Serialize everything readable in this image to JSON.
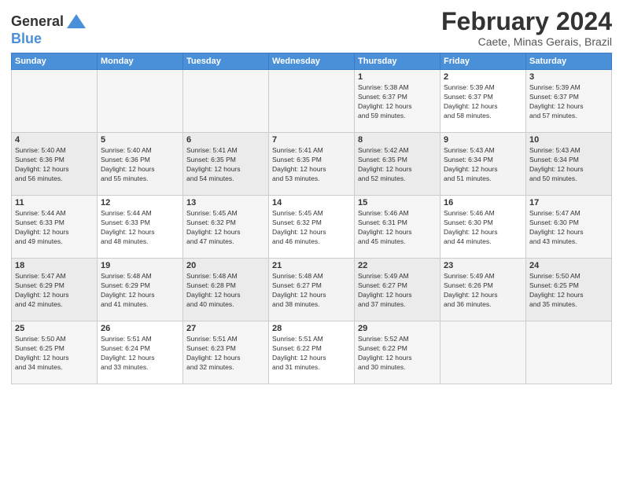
{
  "header": {
    "logo_line1": "General",
    "logo_line2": "Blue",
    "title": "February 2024",
    "subtitle": "Caete, Minas Gerais, Brazil"
  },
  "weekdays": [
    "Sunday",
    "Monday",
    "Tuesday",
    "Wednesday",
    "Thursday",
    "Friday",
    "Saturday"
  ],
  "weeks": [
    [
      {
        "day": "",
        "info": ""
      },
      {
        "day": "",
        "info": ""
      },
      {
        "day": "",
        "info": ""
      },
      {
        "day": "",
        "info": ""
      },
      {
        "day": "1",
        "info": "Sunrise: 5:38 AM\nSunset: 6:37 PM\nDaylight: 12 hours\nand 59 minutes."
      },
      {
        "day": "2",
        "info": "Sunrise: 5:39 AM\nSunset: 6:37 PM\nDaylight: 12 hours\nand 58 minutes."
      },
      {
        "day": "3",
        "info": "Sunrise: 5:39 AM\nSunset: 6:37 PM\nDaylight: 12 hours\nand 57 minutes."
      }
    ],
    [
      {
        "day": "4",
        "info": "Sunrise: 5:40 AM\nSunset: 6:36 PM\nDaylight: 12 hours\nand 56 minutes."
      },
      {
        "day": "5",
        "info": "Sunrise: 5:40 AM\nSunset: 6:36 PM\nDaylight: 12 hours\nand 55 minutes."
      },
      {
        "day": "6",
        "info": "Sunrise: 5:41 AM\nSunset: 6:35 PM\nDaylight: 12 hours\nand 54 minutes."
      },
      {
        "day": "7",
        "info": "Sunrise: 5:41 AM\nSunset: 6:35 PM\nDaylight: 12 hours\nand 53 minutes."
      },
      {
        "day": "8",
        "info": "Sunrise: 5:42 AM\nSunset: 6:35 PM\nDaylight: 12 hours\nand 52 minutes."
      },
      {
        "day": "9",
        "info": "Sunrise: 5:43 AM\nSunset: 6:34 PM\nDaylight: 12 hours\nand 51 minutes."
      },
      {
        "day": "10",
        "info": "Sunrise: 5:43 AM\nSunset: 6:34 PM\nDaylight: 12 hours\nand 50 minutes."
      }
    ],
    [
      {
        "day": "11",
        "info": "Sunrise: 5:44 AM\nSunset: 6:33 PM\nDaylight: 12 hours\nand 49 minutes."
      },
      {
        "day": "12",
        "info": "Sunrise: 5:44 AM\nSunset: 6:33 PM\nDaylight: 12 hours\nand 48 minutes."
      },
      {
        "day": "13",
        "info": "Sunrise: 5:45 AM\nSunset: 6:32 PM\nDaylight: 12 hours\nand 47 minutes."
      },
      {
        "day": "14",
        "info": "Sunrise: 5:45 AM\nSunset: 6:32 PM\nDaylight: 12 hours\nand 46 minutes."
      },
      {
        "day": "15",
        "info": "Sunrise: 5:46 AM\nSunset: 6:31 PM\nDaylight: 12 hours\nand 45 minutes."
      },
      {
        "day": "16",
        "info": "Sunrise: 5:46 AM\nSunset: 6:30 PM\nDaylight: 12 hours\nand 44 minutes."
      },
      {
        "day": "17",
        "info": "Sunrise: 5:47 AM\nSunset: 6:30 PM\nDaylight: 12 hours\nand 43 minutes."
      }
    ],
    [
      {
        "day": "18",
        "info": "Sunrise: 5:47 AM\nSunset: 6:29 PM\nDaylight: 12 hours\nand 42 minutes."
      },
      {
        "day": "19",
        "info": "Sunrise: 5:48 AM\nSunset: 6:29 PM\nDaylight: 12 hours\nand 41 minutes."
      },
      {
        "day": "20",
        "info": "Sunrise: 5:48 AM\nSunset: 6:28 PM\nDaylight: 12 hours\nand 40 minutes."
      },
      {
        "day": "21",
        "info": "Sunrise: 5:48 AM\nSunset: 6:27 PM\nDaylight: 12 hours\nand 38 minutes."
      },
      {
        "day": "22",
        "info": "Sunrise: 5:49 AM\nSunset: 6:27 PM\nDaylight: 12 hours\nand 37 minutes."
      },
      {
        "day": "23",
        "info": "Sunrise: 5:49 AM\nSunset: 6:26 PM\nDaylight: 12 hours\nand 36 minutes."
      },
      {
        "day": "24",
        "info": "Sunrise: 5:50 AM\nSunset: 6:25 PM\nDaylight: 12 hours\nand 35 minutes."
      }
    ],
    [
      {
        "day": "25",
        "info": "Sunrise: 5:50 AM\nSunset: 6:25 PM\nDaylight: 12 hours\nand 34 minutes."
      },
      {
        "day": "26",
        "info": "Sunrise: 5:51 AM\nSunset: 6:24 PM\nDaylight: 12 hours\nand 33 minutes."
      },
      {
        "day": "27",
        "info": "Sunrise: 5:51 AM\nSunset: 6:23 PM\nDaylight: 12 hours\nand 32 minutes."
      },
      {
        "day": "28",
        "info": "Sunrise: 5:51 AM\nSunset: 6:22 PM\nDaylight: 12 hours\nand 31 minutes."
      },
      {
        "day": "29",
        "info": "Sunrise: 5:52 AM\nSunset: 6:22 PM\nDaylight: 12 hours\nand 30 minutes."
      },
      {
        "day": "",
        "info": ""
      },
      {
        "day": "",
        "info": ""
      }
    ]
  ]
}
